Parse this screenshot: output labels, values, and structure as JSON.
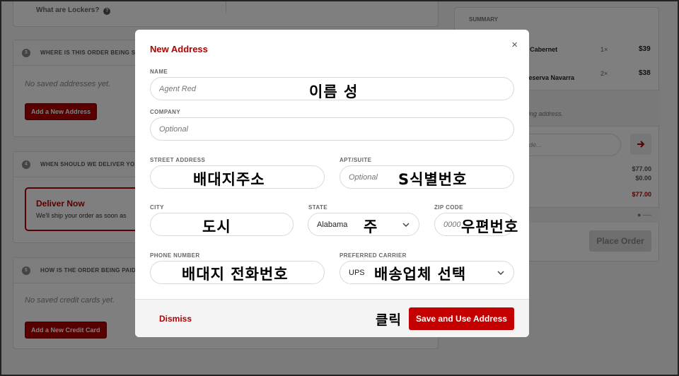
{
  "background": {
    "lockers_text": "What are Lockers?",
    "section3": {
      "num": "3",
      "title": "WHERE IS THIS ORDER BEING SEN",
      "empty": "No saved addresses yet.",
      "button": "Add a New Address"
    },
    "section4": {
      "num": "4",
      "title": "WHEN SHOULD WE DELIVER YOU",
      "deliver_title": "Deliver Now",
      "deliver_text": "We'll ship your order as soon as"
    },
    "section5": {
      "num": "5",
      "title": "HOW IS THE ORDER BEING PAID F",
      "empty": "No saved credit cards yet.",
      "button": "Add a New Credit Card"
    },
    "summary": {
      "title": "SUMMARY",
      "items": [
        {
          "name": "r' Cabernet",
          "qty": "1×",
          "price": "$39"
        },
        {
          "name": "Reserva Navarra",
          "qty": "2×",
          "price": "$38"
        }
      ],
      "note": "ing address.",
      "promo_placeholder": "de...",
      "subtotal": "$77.00",
      "tax": "$0.00",
      "total": "$77.00",
      "misc": "----",
      "place_order": "Place Order"
    }
  },
  "modal": {
    "title": "New Address",
    "close": "×",
    "fields": {
      "name": {
        "label": "NAME",
        "placeholder": "Agent Red",
        "annotation": "이름 성"
      },
      "company": {
        "label": "COMPANY",
        "placeholder": "Optional"
      },
      "street": {
        "label": "STREET ADDRESS",
        "placeholder": "",
        "annotation": "배대지주소"
      },
      "apt": {
        "label": "APT/SUITE",
        "placeholder": "Optional",
        "annotation": "S식별번호"
      },
      "city": {
        "label": "CITY",
        "placeholder": "",
        "annotation": "도시"
      },
      "state": {
        "label": "STATE",
        "value": "Alabama",
        "annotation": "주"
      },
      "zip": {
        "label": "ZIP CODE",
        "placeholder": "0000",
        "annotation": "우편번호"
      },
      "phone": {
        "label": "PHONE NUMBER",
        "placeholder": "",
        "annotation": "배대지 전화번호"
      },
      "carrier": {
        "label": "PREFERRED CARRIER",
        "value": "UPS",
        "annotation": "배송업체 선택"
      }
    },
    "footer": {
      "dismiss": "Dismiss",
      "click_annotation": "클릭",
      "save": "Save and Use Address"
    }
  }
}
